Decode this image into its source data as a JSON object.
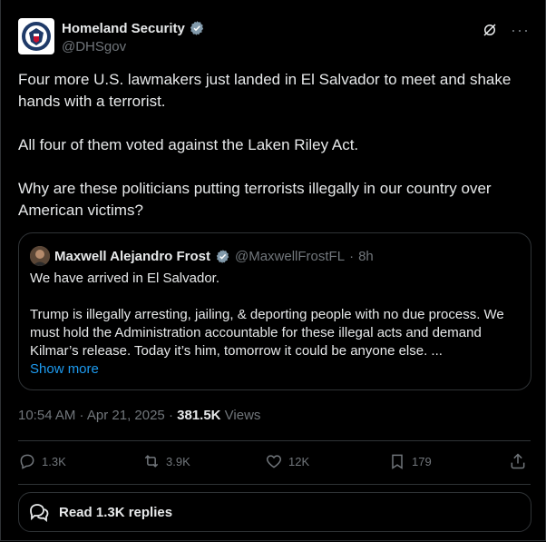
{
  "author": {
    "name": "Homeland Security",
    "handle": "@DHSgov"
  },
  "post": {
    "paragraphs": [
      "Four more U.S. lawmakers just landed in El Salvador to meet and shake hands with a terrorist.",
      "All four of them voted against the Laken Riley Act.",
      "Why are these politicians putting terrorists illegally in our country over American victims?"
    ]
  },
  "quoted": {
    "name": "Maxwell Alejandro Frost",
    "handle": "@MaxwellFrostFL",
    "separator": "·",
    "time": "8h",
    "paragraphs": [
      "We have arrived in El Salvador.",
      "Trump is illegally arresting, jailing, & deporting people with no due process. We must hold the Administration accountable for these illegal acts and demand Kilmar’s release. Today it’s him, tomorrow it could be anyone else. ..."
    ],
    "show_more": "Show more"
  },
  "meta": {
    "timestamp": "10:54 AM · Apr 21, 2025",
    "dot": "·",
    "views_count": "381.5K",
    "views_label": "Views"
  },
  "actions": {
    "replies": "1.3K",
    "reposts": "3.9K",
    "likes": "12K",
    "bookmarks": "179"
  },
  "read_replies": "Read 1.3K replies",
  "icons": [
    "dhs-seal-icon",
    "verified-icon",
    "grok-icon",
    "more-icon",
    "reply-icon",
    "repost-icon",
    "like-icon",
    "bookmark-icon",
    "share-icon",
    "chat-bubbles-icon"
  ],
  "colors": {
    "background": "#000000",
    "text": "#e7e9ea",
    "muted": "#71767b",
    "link": "#1d9bf0",
    "verified": "#829aab",
    "border": "#2f3336"
  }
}
